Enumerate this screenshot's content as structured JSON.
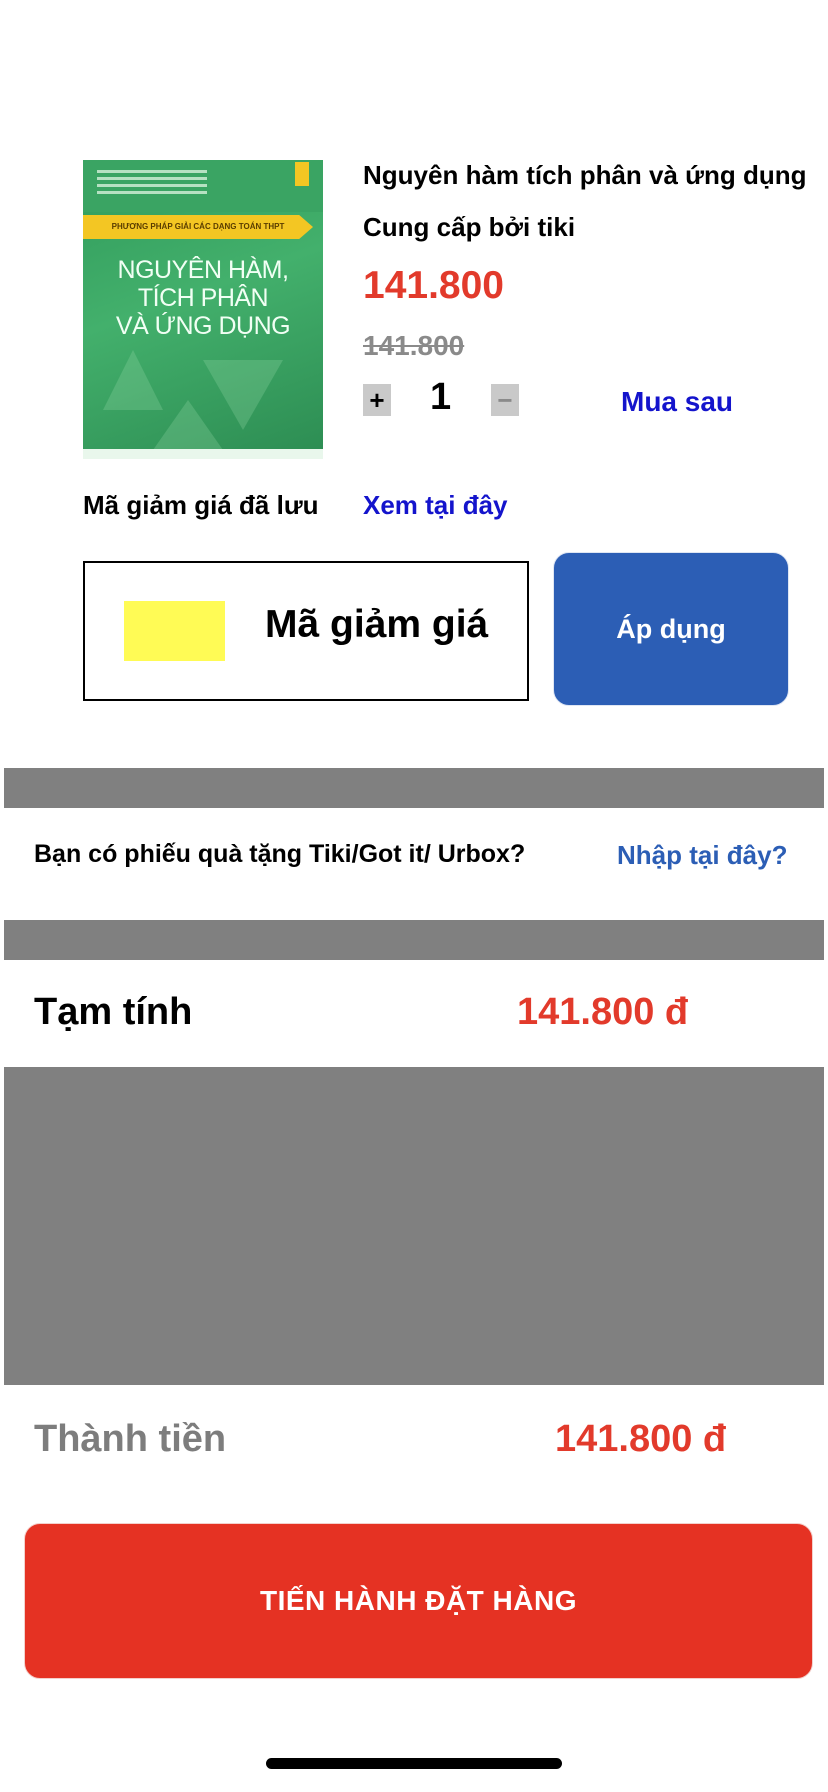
{
  "product": {
    "cover": {
      "banner": "PHƯƠNG PHÁP GIẢI CÁC DẠNG TOÁN THPT",
      "title_line1": "NGUYÊN HÀM,",
      "title_line2": "TÍCH PHÂN",
      "title_line3": "VÀ ỨNG DỤNG"
    },
    "title": "Nguyên hàm tích phân và ứng dụng",
    "provider": "Cung cấp bởi tiki",
    "price": "141.800",
    "old_price": "141.800",
    "quantity": "1",
    "plus_symbol": "+",
    "minus_symbol": "−",
    "buy_later": "Mua sau"
  },
  "coupon": {
    "saved_label": "Mã giảm giá đã lưu",
    "saved_link": "Xem tại đây",
    "input_label": "Mã giảm giá",
    "apply_button": "Áp dụng",
    "swatch_color": "#fffb55"
  },
  "gift": {
    "question": "Bạn có phiếu quà tặng Tiki/Got it/ Urbox?",
    "link": "Nhập tại đây?"
  },
  "summary": {
    "subtotal_label": "Tạm tính",
    "subtotal_value": "141.800 đ",
    "total_label": "Thành tiền",
    "total_value": "141.800 đ"
  },
  "checkout": {
    "button": "TIẾN HÀNH ĐẶT HÀNG"
  },
  "colors": {
    "price_red": "#e23a2b",
    "link_blue": "#1414cc",
    "apply_blue": "#2c5eb5",
    "checkout_red": "#e53223",
    "divider_gray": "#808080"
  }
}
